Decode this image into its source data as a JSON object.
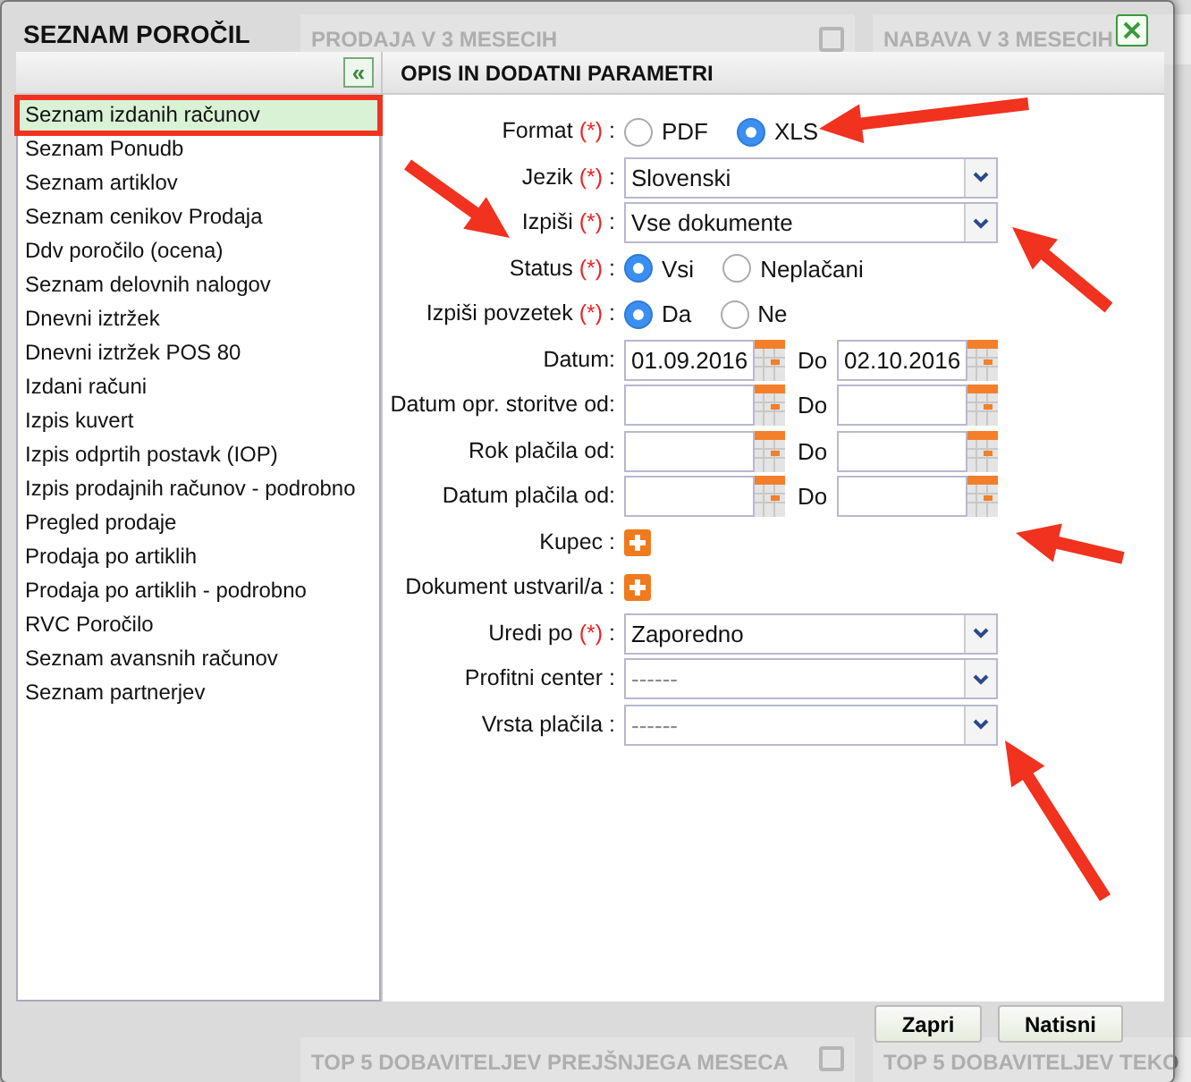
{
  "backdrop": {
    "top_tiles": [
      {
        "title": "PRODAJA V 3 MESECIH"
      },
      {
        "title": "NABAVA V 3 MESECIH"
      }
    ],
    "bottom_tiles": [
      {
        "title": "TOP 5 DOBAVITELJEV PREJŠNJEGA MESECA"
      },
      {
        "title": "TOP 5 DOBAVITELJEV TEKO"
      }
    ]
  },
  "dialog": {
    "title": "SEZNAM POROČIL",
    "collapse_symbol": "«",
    "reports": [
      {
        "label": "Seznam izdanih računov",
        "selected": true
      },
      {
        "label": "Seznam Ponudb",
        "selected": false
      },
      {
        "label": "Seznam artiklov",
        "selected": false
      },
      {
        "label": "Seznam cenikov Prodaja",
        "selected": false
      },
      {
        "label": "Ddv poročilo (ocena)",
        "selected": false
      },
      {
        "label": "Seznam delovnih nalogov",
        "selected": false
      },
      {
        "label": "Dnevni iztržek",
        "selected": false
      },
      {
        "label": "Dnevni iztržek POS 80",
        "selected": false
      },
      {
        "label": "Izdani računi",
        "selected": false
      },
      {
        "label": "Izpis kuvert",
        "selected": false
      },
      {
        "label": "Izpis odprtih postavk (IOP)",
        "selected": false
      },
      {
        "label": "Izpis prodajnih računov - podrobno",
        "selected": false
      },
      {
        "label": "Pregled prodaje",
        "selected": false
      },
      {
        "label": "Prodaja po artiklih",
        "selected": false
      },
      {
        "label": "Prodaja po artiklih - podrobno",
        "selected": false
      },
      {
        "label": "RVC Poročilo",
        "selected": false
      },
      {
        "label": "Seznam avansnih računov",
        "selected": false
      },
      {
        "label": "Seznam partnerjev",
        "selected": false
      }
    ],
    "params_title": "OPIS IN DODATNI PARAMETRI",
    "fields": [
      {
        "kind": "radio",
        "label": "Format",
        "required": "(*)",
        "colon": ":",
        "options": [
          {
            "label": "PDF",
            "selected": false
          },
          {
            "label": "XLS",
            "selected": true
          }
        ]
      },
      {
        "kind": "select",
        "label": "Jezik",
        "required": "(*)",
        "colon": ":",
        "value": "Slovenski"
      },
      {
        "kind": "select",
        "label": "Izpiši",
        "required": "(*)",
        "colon": ":",
        "value": "Vse dokumente"
      },
      {
        "kind": "radio",
        "label": "Status",
        "required": "(*)",
        "colon": ":",
        "options": [
          {
            "label": "Vsi",
            "selected": true
          },
          {
            "label": "Neplačani",
            "selected": false
          }
        ]
      },
      {
        "kind": "radio",
        "label": "Izpiši povzetek",
        "required": "(*)",
        "colon": ":",
        "options": [
          {
            "label": "Da",
            "selected": true
          },
          {
            "label": "Ne",
            "selected": false
          }
        ]
      },
      {
        "kind": "daterange",
        "label": "Datum:",
        "from": "01.09.2016",
        "to_label": "Do",
        "to": "02.10.2016"
      },
      {
        "kind": "daterange",
        "label": "Datum opr. storitve od:",
        "to_label": "Do"
      },
      {
        "kind": "daterange",
        "label": "Rok plačila od:",
        "to_label": "Do"
      },
      {
        "kind": "daterange",
        "label": "Datum plačila od:",
        "to_label": "Do"
      },
      {
        "kind": "add",
        "label": "Kupec :"
      },
      {
        "kind": "add",
        "label": "Dokument ustvaril/a :"
      },
      {
        "kind": "select",
        "label": "Uredi po",
        "required": "(*)",
        "colon": ":",
        "value": "Zaporedno"
      },
      {
        "kind": "select",
        "label": "Profitni center :",
        "placeholder": "------"
      },
      {
        "kind": "select",
        "label": "Vrsta plačila :",
        "placeholder": "------"
      }
    ],
    "buttons": [
      {
        "label": "Zapri"
      },
      {
        "label": "Natisni"
      }
    ]
  }
}
